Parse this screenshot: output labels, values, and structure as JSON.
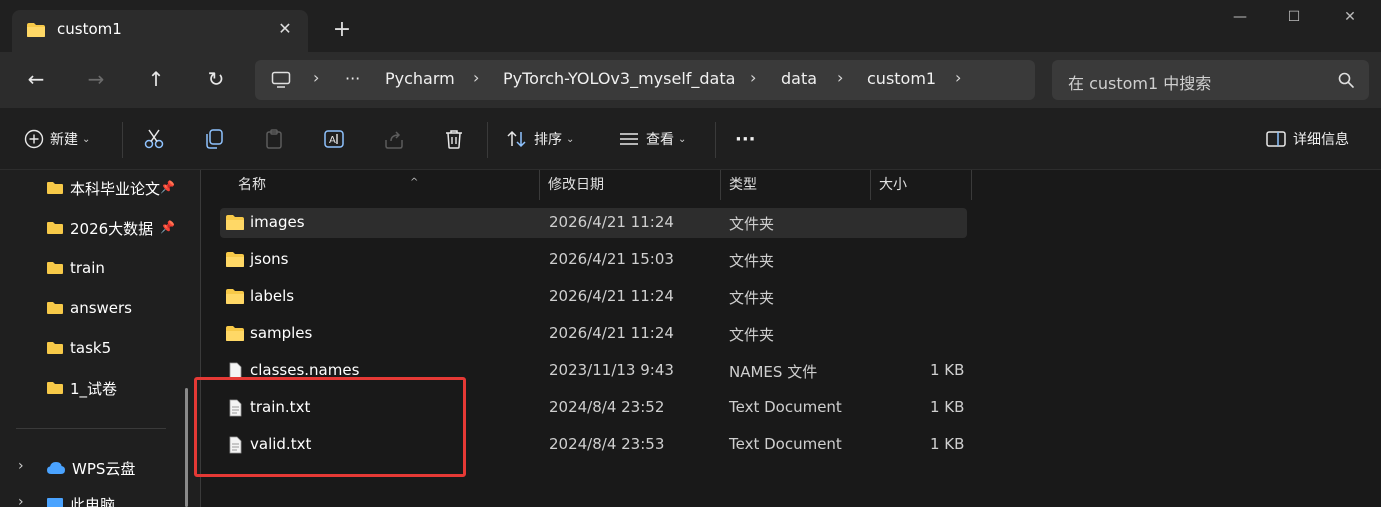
{
  "tab": {
    "title": "custom1",
    "close": "✕",
    "new_tab": "+"
  },
  "window_controls": {
    "minimize": "—",
    "maximize": "☐",
    "close": "✕"
  },
  "nav": {
    "back": "←",
    "forward": "→",
    "up": "↑",
    "refresh": "↻"
  },
  "address": {
    "more": "···",
    "sep": "›",
    "crumbs": [
      "Pycharm",
      "PyTorch-YOLOv3_myself_data",
      "data",
      "custom1"
    ]
  },
  "search": {
    "placeholder": "在 custom1 中搜索"
  },
  "toolbar": {
    "new_label": "新建",
    "sort_label": "排序",
    "view_label": "查看",
    "more_label": "···",
    "details_label": "详细信息"
  },
  "sidebar": {
    "items": [
      {
        "label": "本科毕业论文",
        "pinned": true
      },
      {
        "label": "2026大数据",
        "pinned": true
      },
      {
        "label": "train",
        "pinned": false
      },
      {
        "label": "answers",
        "pinned": false
      },
      {
        "label": "task5",
        "pinned": false
      },
      {
        "label": "1_试卷",
        "pinned": false
      }
    ],
    "wps": "WPS云盘",
    "computer": "此电脑",
    "pin_icon": "📌"
  },
  "columns": {
    "name": "名称",
    "modified": "修改日期",
    "type": "类型",
    "size": "大小"
  },
  "files": [
    {
      "name": "images",
      "modified": "2026/4/21 11:24",
      "type": "文件夹",
      "size": "",
      "kind": "folder"
    },
    {
      "name": "jsons",
      "modified": "2026/4/21 15:03",
      "type": "文件夹",
      "size": "",
      "kind": "folder"
    },
    {
      "name": "labels",
      "modified": "2026/4/21 11:24",
      "type": "文件夹",
      "size": "",
      "kind": "folder"
    },
    {
      "name": "samples",
      "modified": "2026/4/21 11:24",
      "type": "文件夹",
      "size": "",
      "kind": "folder"
    },
    {
      "name": "classes.names",
      "modified": "2023/11/13 9:43",
      "type": "NAMES 文件",
      "size": "1 KB",
      "kind": "file"
    },
    {
      "name": "train.txt",
      "modified": "2024/8/4 23:52",
      "type": "Text Document",
      "size": "1 KB",
      "kind": "text"
    },
    {
      "name": "valid.txt",
      "modified": "2024/8/4 23:53",
      "type": "Text Document",
      "size": "1 KB",
      "kind": "text"
    }
  ],
  "colors": {
    "folder": "#f7c948",
    "highlight": "#e53935",
    "accent": "#4aa3ff"
  }
}
